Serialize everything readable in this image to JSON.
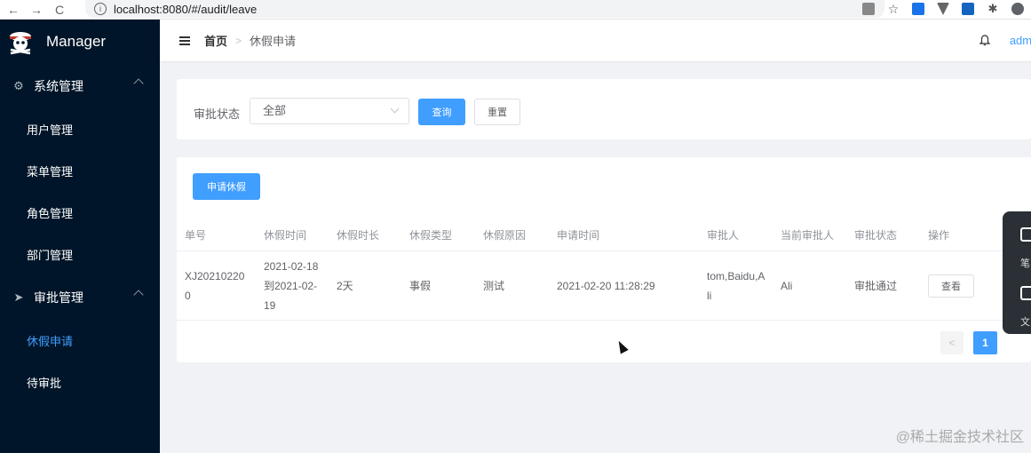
{
  "browser": {
    "url": "localhost:8080/#/audit/leave",
    "back": "←",
    "forward": "→",
    "reload": "C",
    "info": "i"
  },
  "sidebar": {
    "brand": "Manager",
    "groups": [
      {
        "label": "系统管理",
        "items": [
          "用户管理",
          "菜单管理",
          "角色管理",
          "部门管理"
        ]
      },
      {
        "label": "审批管理",
        "items": [
          "休假申请",
          "待审批"
        ]
      }
    ],
    "active_item": "休假申请"
  },
  "header": {
    "breadcrumb": [
      "首页",
      "休假申请"
    ],
    "breadcrumb_separator": ">",
    "user": "admi"
  },
  "query": {
    "label": "审批状态",
    "select_value": "全部",
    "search_button": "查询",
    "reset_button": "重置"
  },
  "list": {
    "apply_button": "申请休假",
    "columns": [
      "单号",
      "休假时间",
      "休假时长",
      "休假类型",
      "休假原因",
      "申请时间",
      "审批人",
      "当前审批人",
      "审批状态",
      "操作"
    ],
    "rows": [
      {
        "id_line1": "XJ20210220",
        "id_line2": "0",
        "time_line1": "2021-02-18",
        "time_line2": "到2021-02-",
        "time_line3": "19",
        "duration": "2天",
        "type": "事假",
        "reason": "测试",
        "apply_time": "2021-02-20 11:28:29",
        "approvers_line1": "tom,Baidu,A",
        "approvers_line2": "li",
        "current_approver": "Ali",
        "status": "审批通过",
        "action": "查看"
      }
    ],
    "pagination": {
      "prev": "<",
      "current_page": "1"
    }
  },
  "floating_widget": {
    "text1": "笔",
    "text2": "文"
  },
  "watermark": "@稀土掘金技术社区",
  "colors": {
    "sidebar_bg": "#001529",
    "primary": "#409eff",
    "page_bg": "#f0f2f5"
  }
}
